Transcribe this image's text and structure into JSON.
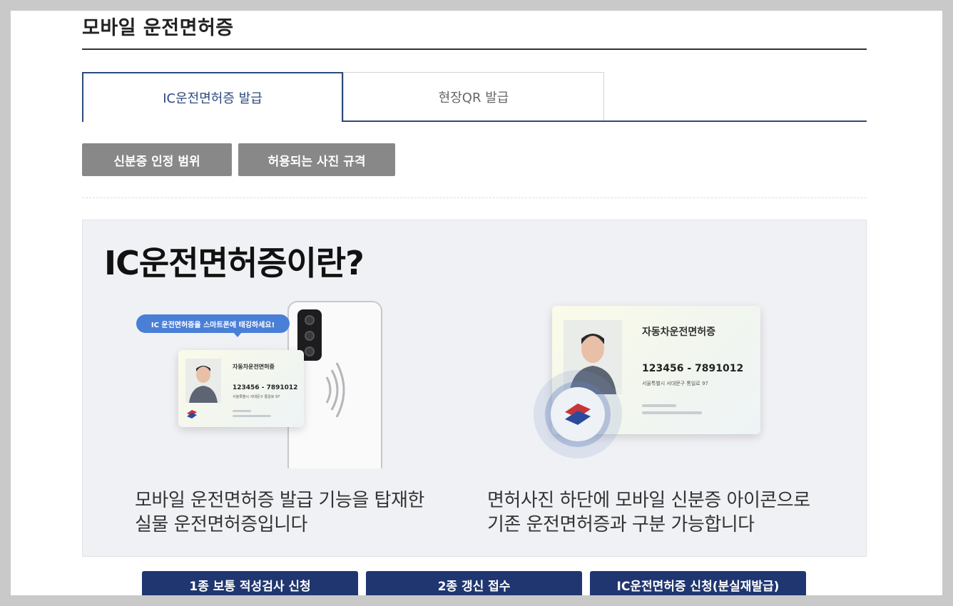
{
  "page": {
    "title": "모바일 운전면허증"
  },
  "tabs": [
    {
      "label": "IC운전면허증 발급",
      "active": true
    },
    {
      "label": "현장QR 발급",
      "active": false
    }
  ],
  "info_buttons": [
    {
      "label": "신분증 인정 범위"
    },
    {
      "label": "허용되는 사진 규격"
    }
  ],
  "panel": {
    "heading": "IC운전면허증이란?",
    "left_illustration": {
      "bubble": "IC 운전면허증을 스마트폰에 태깅하세요!",
      "card_title": "자동차운전면허증",
      "card_number": "123456 - 7891012",
      "card_address": "서울특별시 서대문구 통일로 97"
    },
    "right_illustration": {
      "card_title": "자동차운전면허증",
      "card_number": "123456 - 7891012",
      "card_address": "서울특별시 서대문구 통일로 97"
    },
    "left_desc": [
      "모바일 운전면허증 발급 기능을 탑재한",
      "실물 운전면허증입니다"
    ],
    "right_desc": [
      "면허사진 하단에 모바일 신분증 아이콘으로",
      "기존 운전면허증과 구분 가능합니다"
    ]
  },
  "action_buttons": [
    {
      "label": "1종 보통 적성검사 신청"
    },
    {
      "label": "2종 갱신 접수"
    },
    {
      "label": "IC운전면허증 신청(분실재발급)"
    }
  ],
  "colors": {
    "accent": "#2c4a7c",
    "action_button": "#203670",
    "info_button": "#888888",
    "panel_bg": "#f0f1f4",
    "bubble": "#4a7fd8"
  }
}
